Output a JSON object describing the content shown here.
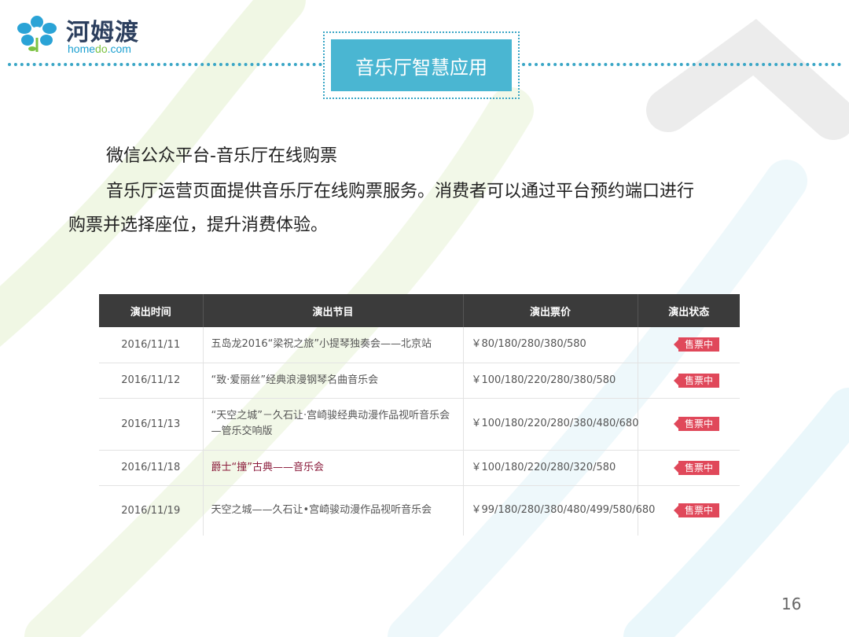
{
  "logo": {
    "cn": "河姆渡",
    "en_prefix": "home",
    "en_accent": "do",
    "en_suffix": ".com"
  },
  "header": {
    "title": "音乐厅智慧应用"
  },
  "body": {
    "line1": "微信公众平台-音乐厅在线购票",
    "line2": "音乐厅运营页面提供音乐厅在线购票服务。消费者可以通过平台预约端口进行",
    "line3": "购票并选择座位，提升消费体验。"
  },
  "table": {
    "headers": [
      "演出时间",
      "演出节目",
      "演出票价",
      "演出状态"
    ],
    "rows": [
      {
        "date": "2016/11/11",
        "program": "五岛龙2016“梁祝之旅”小提琴独奏会——北京站",
        "price": "￥80/180/280/380/580",
        "status": "售票中"
      },
      {
        "date": "2016/11/12",
        "program": "“致·爱丽丝”经典浪漫钢琴名曲音乐会",
        "price": "￥100/180/220/280/380/580",
        "status": "售票中"
      },
      {
        "date": "2016/11/13",
        "program": "“天空之城”－久石让·宫崎骏经典动漫作品视听音乐会—管乐交响版",
        "price": "￥100/180/220/280/380/480/680",
        "status": "售票中"
      },
      {
        "date": "2016/11/18",
        "program": "爵士“撞”古典——音乐会",
        "price": "￥100/180/220/280/320/580",
        "status": "售票中"
      },
      {
        "date": "2016/11/19",
        "program": "天空之城——久石让•宫崎骏动漫作品视听音乐会",
        "price": "￥99/180/280/380/480/499/580/680",
        "status": "售票中"
      }
    ]
  },
  "footer": {
    "page_number": "16"
  },
  "colors": {
    "accent": "#4ab6d2",
    "dots": "#3aa6c6",
    "badge": "#e0485a",
    "table_header": "#3b3b3b"
  }
}
